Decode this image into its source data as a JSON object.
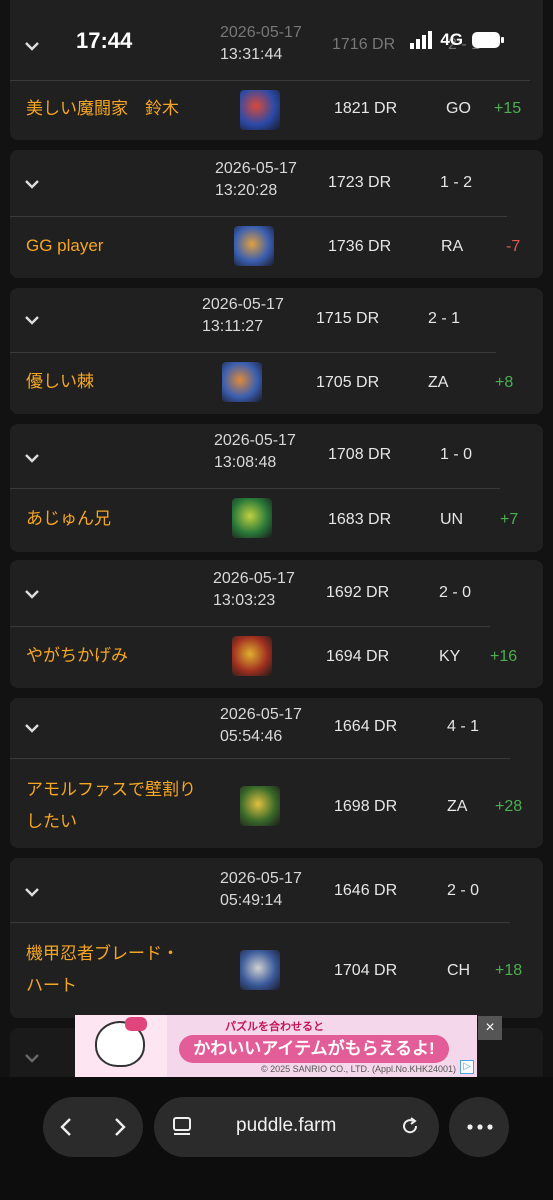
{
  "status_bar": {
    "time": "17:44",
    "network": "4G"
  },
  "matches": [
    {
      "datetime": [
        "2026-05-17",
        "13:31:44"
      ],
      "opponent_dr": "1716 DR",
      "score": "2 - 1",
      "player": [
        "美しい魔闘家　鈴木"
      ],
      "player_dr": "1821 DR",
      "character": "GO",
      "delta": "+15",
      "delta_sign": "pos"
    },
    {
      "datetime": [
        "2026-05-17",
        "13:20:28"
      ],
      "opponent_dr": "1723 DR",
      "score": "1 - 2",
      "player": [
        "GG player"
      ],
      "player_dr": "1736 DR",
      "character": "RA",
      "delta": "-7",
      "delta_sign": "neg"
    },
    {
      "datetime": [
        "2026-05-17",
        "13:11:27"
      ],
      "opponent_dr": "1715 DR",
      "score": "2 - 1",
      "player": [
        "優しい棘"
      ],
      "player_dr": "1705 DR",
      "character": "ZA",
      "delta": "+8",
      "delta_sign": "pos"
    },
    {
      "datetime": [
        "2026-05-17",
        "13:08:48"
      ],
      "opponent_dr": "1708 DR",
      "score": "1 - 0",
      "player": [
        "あじゅん兄"
      ],
      "player_dr": "1683 DR",
      "character": "UN",
      "delta": "+7",
      "delta_sign": "pos"
    },
    {
      "datetime": [
        "2026-05-17",
        "13:03:23"
      ],
      "opponent_dr": "1692 DR",
      "score": "2 - 0",
      "player": [
        "やがちかげみ"
      ],
      "player_dr": "1694 DR",
      "character": "KY",
      "delta": "+16",
      "delta_sign": "pos"
    },
    {
      "datetime": [
        "2026-05-17",
        "05:54:46"
      ],
      "opponent_dr": "1664 DR",
      "score": "4 - 1",
      "player": [
        "アモルファスで壁割り",
        "したい"
      ],
      "player_dr": "1698 DR",
      "character": "ZA",
      "delta": "+28",
      "delta_sign": "pos"
    },
    {
      "datetime": [
        "2026-05-17",
        "05:49:14"
      ],
      "opponent_dr": "1646 DR",
      "score": "2 - 0",
      "player": [
        "機甲忍者ブレード・",
        "ハート"
      ],
      "player_dr": "1704 DR",
      "character": "CH",
      "delta": "+18",
      "delta_sign": "pos"
    }
  ],
  "ad": {
    "headline": "かわいいアイテムがもらえるよ!",
    "top_text": "パズルを合わせると",
    "copyright": "© 2025 SANRIO CO., LTD. (Appl.No.KHK24001)",
    "close": "×",
    "info": "▷"
  },
  "browser": {
    "url": "puddle.farm"
  },
  "colors": {
    "accent_name": "#f5a623",
    "positive": "#4caf50",
    "negative": "#e05a4f"
  }
}
